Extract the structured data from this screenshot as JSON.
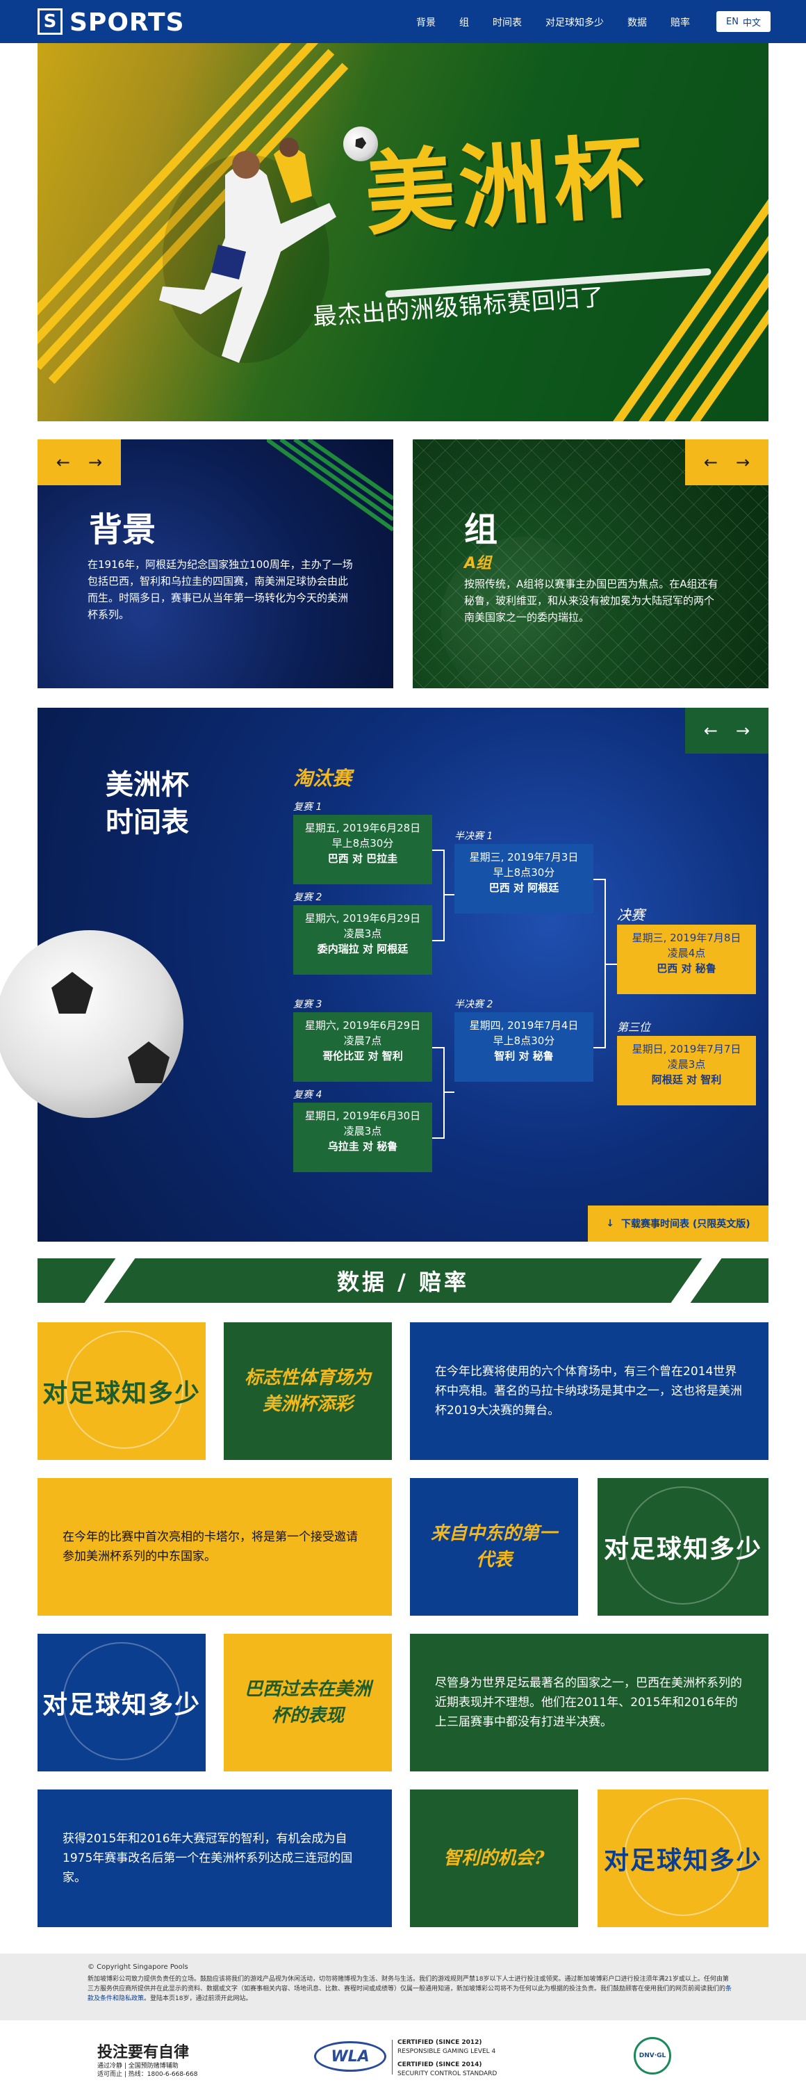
{
  "nav": {
    "brand": "SPORTS",
    "links": [
      "背景",
      "组",
      "时间表",
      "对足球知多少",
      "数据",
      "赔率"
    ],
    "lang_en": "EN",
    "lang_zh": "中文"
  },
  "hero": {
    "title": "美洲杯",
    "subtitle": "最杰出的洲级锦标赛回归了"
  },
  "background_panel": {
    "heading": "背景",
    "text": "在1916年，阿根廷为纪念国家独立100周年，主办了一场包括巴西，智利和乌拉圭的四国赛，南美洲足球协会由此而生。时隔多日，赛事已从当年第一场转化为今天的美洲杯系列。"
  },
  "group_panel": {
    "heading": "组",
    "subheading": "A组",
    "text": "按照传统，A组将以赛事主办国巴西为焦点。在A组还有秘鲁，玻利维亚，和从来没有被加冕为大陆冠军的两个南美国家之一的委内瑞拉。"
  },
  "schedule": {
    "title_line1": "美洲杯",
    "title_line2": "时间表",
    "section": "淘汰赛",
    "qf": [
      {
        "round": "复赛 1",
        "date": "星期五, 2019年6月28日",
        "time": "早上8点30分",
        "teams": "巴西 对 巴拉圭"
      },
      {
        "round": "复赛 2",
        "date": "星期六, 2019年6月29日",
        "time": "凌晨3点",
        "teams": "委内瑞拉 对 阿根廷"
      },
      {
        "round": "复赛 3",
        "date": "星期六, 2019年6月29日",
        "time": "凌晨7点",
        "teams": "哥伦比亚 对 智利"
      },
      {
        "round": "复赛 4",
        "date": "星期日, 2019年6月30日",
        "time": "凌晨3点",
        "teams": "乌拉圭 对 秘鲁"
      }
    ],
    "sf": [
      {
        "round": "半决赛 1",
        "date": "星期三, 2019年7月3日",
        "time": "早上8点30分",
        "teams": "巴西 对 阿根廷"
      },
      {
        "round": "半决赛 2",
        "date": "星期四, 2019年7月4日",
        "time": "早上8点30分",
        "teams": "智利 对 秘鲁"
      }
    ],
    "final": {
      "round": "决赛",
      "date": "星期三, 2019年7月8日",
      "time": "凌晨4点",
      "teams": "巴西 对 秘鲁"
    },
    "third": {
      "round": "第三位",
      "date": "星期日, 2019年7月7日",
      "time": "凌晨3点",
      "teams": "阿根廷 对 智利"
    },
    "download": "下载赛事时间表 (只限英文版)"
  },
  "stats_banner": "数据 / 赔率",
  "tiles": {
    "quiz": "对足球知多少",
    "t1_title": "标志性体育场为美洲杯添彩",
    "t1_text": "在今年比赛将使用的六个体育场中，有三个曾在2014世界杯中亮相。著名的马拉卡纳球场是其中之一，这也将是美洲杯2019大决赛的舞台。",
    "t2_text": "在今年的比赛中首次亮相的卡塔尔，将是第一个接受邀请参加美洲杯系列的中东国家。",
    "t2_title": "来自中东的第一代表",
    "t3_title": "巴西过去在美洲杯的表现",
    "t3_text": "尽管身为世界足坛最著名的国家之一，巴西在美洲杯系列的近期表现并不理想。他们在2011年、2015年和2016年的上三届赛事中都没有打进半决赛。",
    "t4_text": "获得2015年和2016年大赛冠军的智利，有机会成为自1975年赛事改名后第一个在美洲杯系列达成三连冠的国家。",
    "t4_title": "智利的机会?"
  },
  "footer": {
    "copyright": "© Copyright Singapore Pools",
    "disclaimer": "新加坡博彩公司致力提供负责任的立场。鼓励应该将我们的游戏产品视为休闲活动，切勿将赌博视为生活、财务与生活。我们的游戏规则严禁18岁以下人士进行投注或领奖。通过新加坡博彩户口进行投注须年满21岁或以上。任何由第三方服务供应商所提供并在此显示的资料、数据或文字（如赛事相关内容、场地讯息、比数、赛程时间或成绩等）仅属一般通用知道，新加坡博彩公司将不为任何以此为根据的投注负责。我们鼓励顾客在使用我们的网页前阅读我们的",
    "terms_link": "条款及条件和隐私政策",
    "disclaimer_end": "。登陆本页18岁，通过前须开此网站。",
    "rg_title": "投注要有自律",
    "rg_line1": "通过冷静 | 全国预防赌博辅助",
    "rg_line2": "适可而止 | 热线：1800-6-668-668",
    "wla_name": "WLA",
    "cert1": "CERTIFIED (SINCE 2012)",
    "cert1b": "RESPONSIBLE GAMING LEVEL 4",
    "cert2": "CERTIFIED (SINCE 2014)",
    "cert2b": "SECURITY CONTROL STANDARD",
    "dnv": "DNV·GL"
  },
  "colors": {
    "nav_blue": "#0a3d8f",
    "yellow": "#f5b81a",
    "green": "#1d5c2c",
    "blue": "#0c3e8f"
  }
}
